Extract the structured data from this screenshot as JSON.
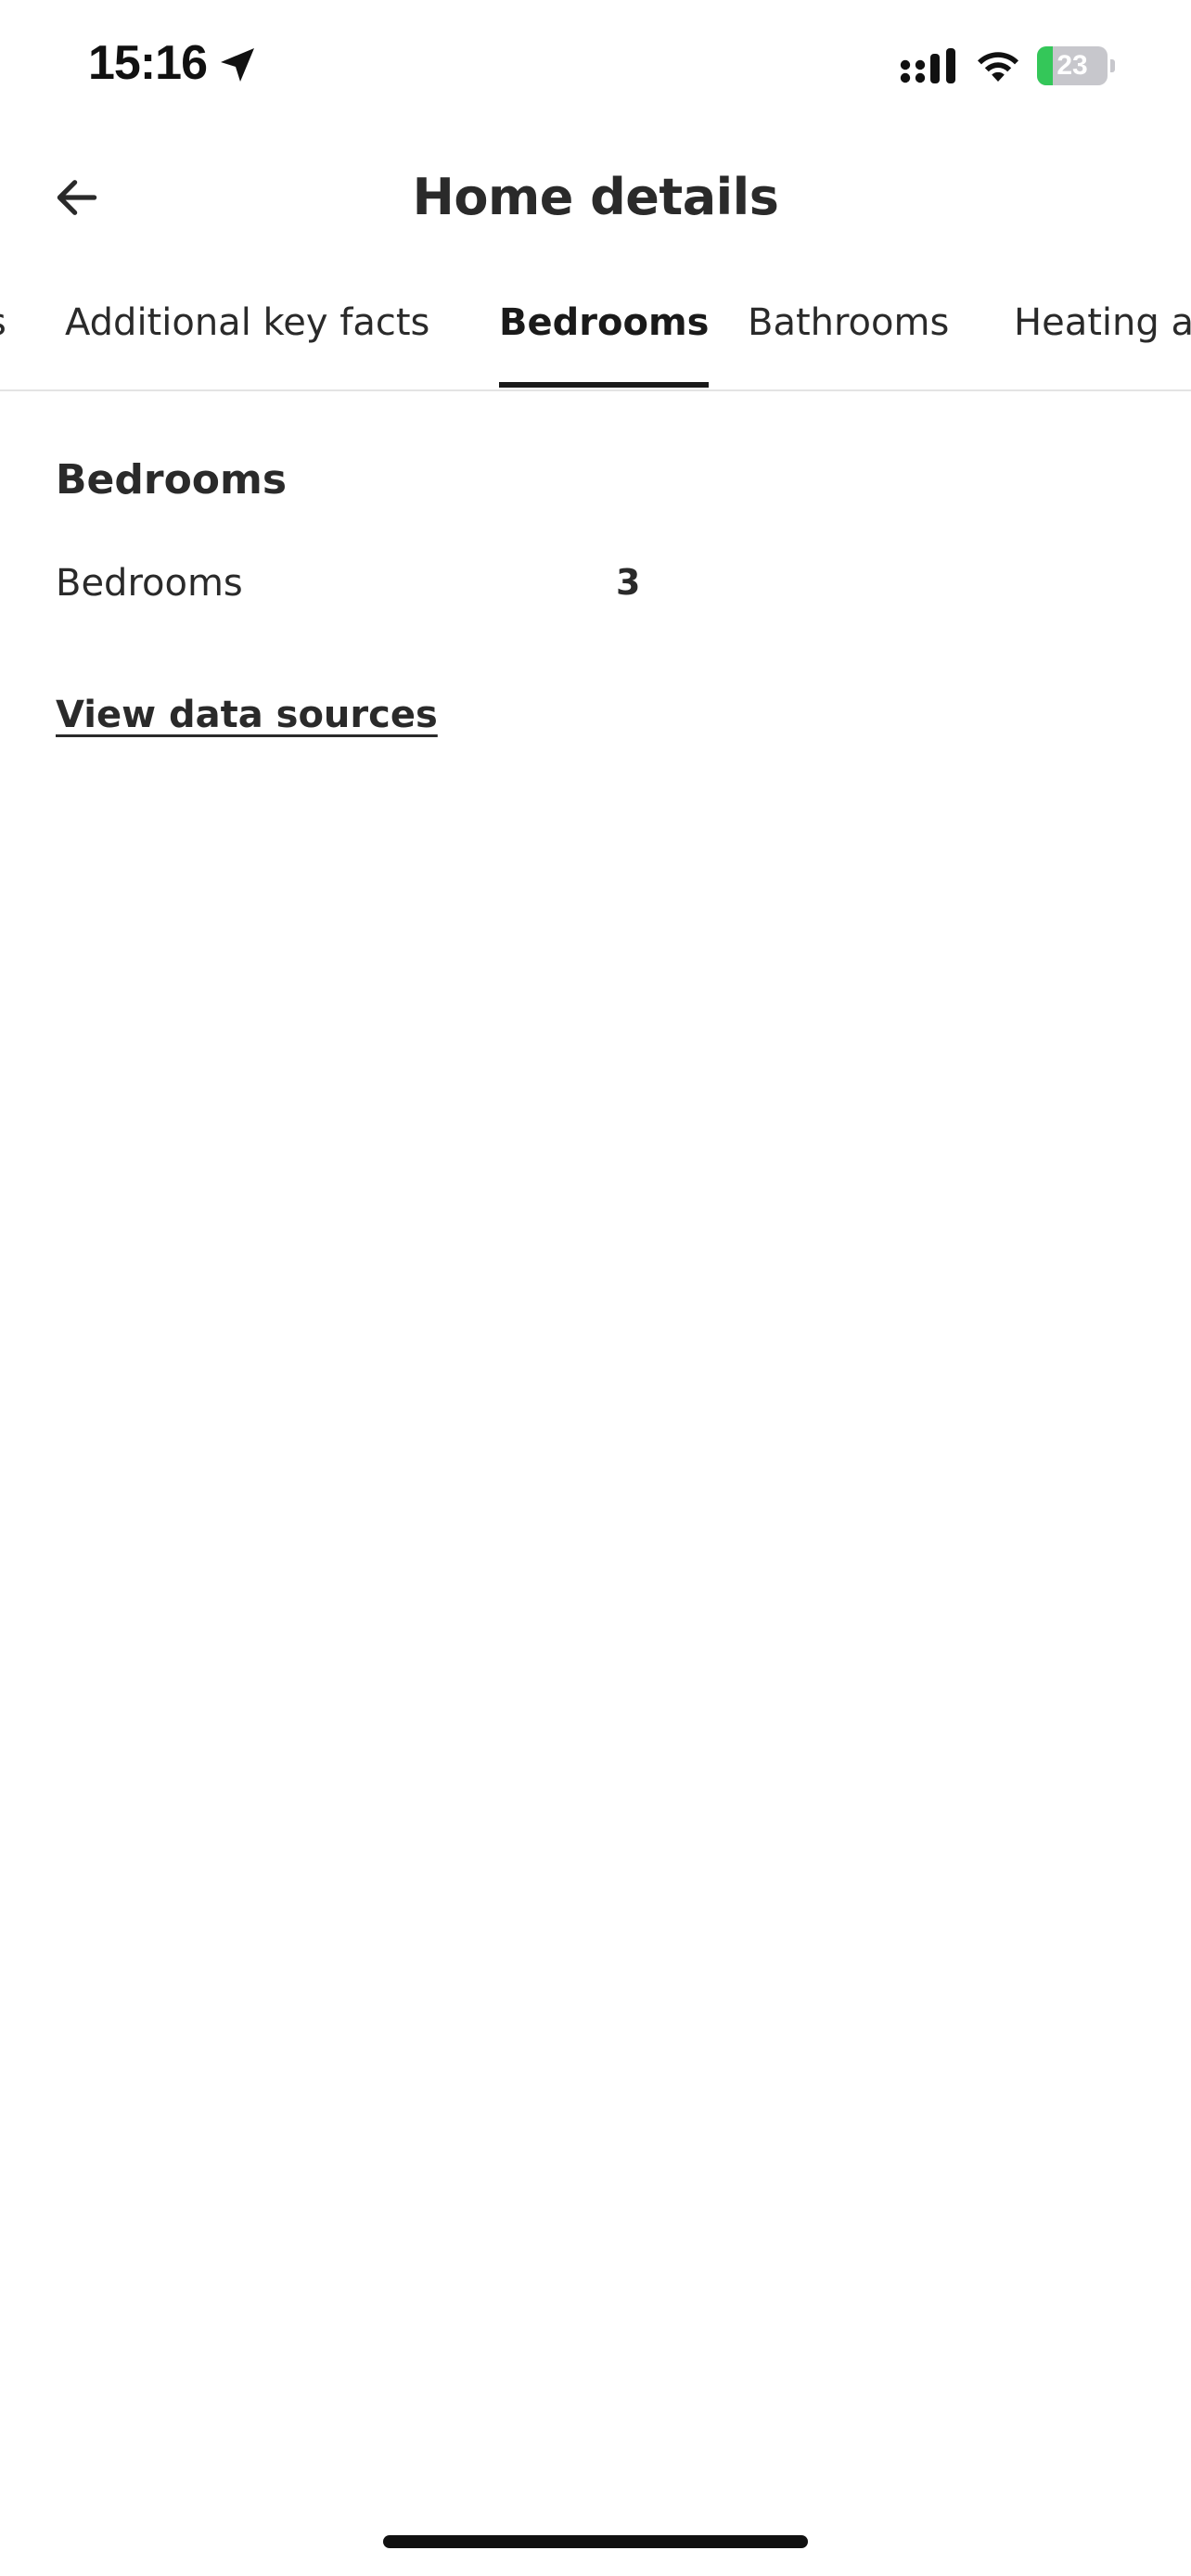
{
  "status_bar": {
    "time": "15:16",
    "battery_level": "23",
    "battery_fraction": 0.23,
    "icons": [
      "location-arrow-icon",
      "cellular-signal-icon",
      "wifi-icon",
      "battery-charging-icon"
    ]
  },
  "header": {
    "title": "Home details",
    "back_icon": "arrow-left-icon"
  },
  "tabs": [
    {
      "label": "s",
      "active": false
    },
    {
      "label": "Additional key facts",
      "active": false
    },
    {
      "label": "Bedrooms",
      "active": true
    },
    {
      "label": "Bathrooms",
      "active": false
    },
    {
      "label": "Heating a",
      "active": false
    }
  ],
  "section": {
    "heading": "Bedrooms",
    "facts": [
      {
        "label": "Bedrooms",
        "value": "3"
      }
    ]
  },
  "links": {
    "data_sources": "View data sources"
  },
  "colors": {
    "text": "#2a2a2a",
    "battery_fill": "#34c759",
    "divider": "#e3e3e3"
  }
}
